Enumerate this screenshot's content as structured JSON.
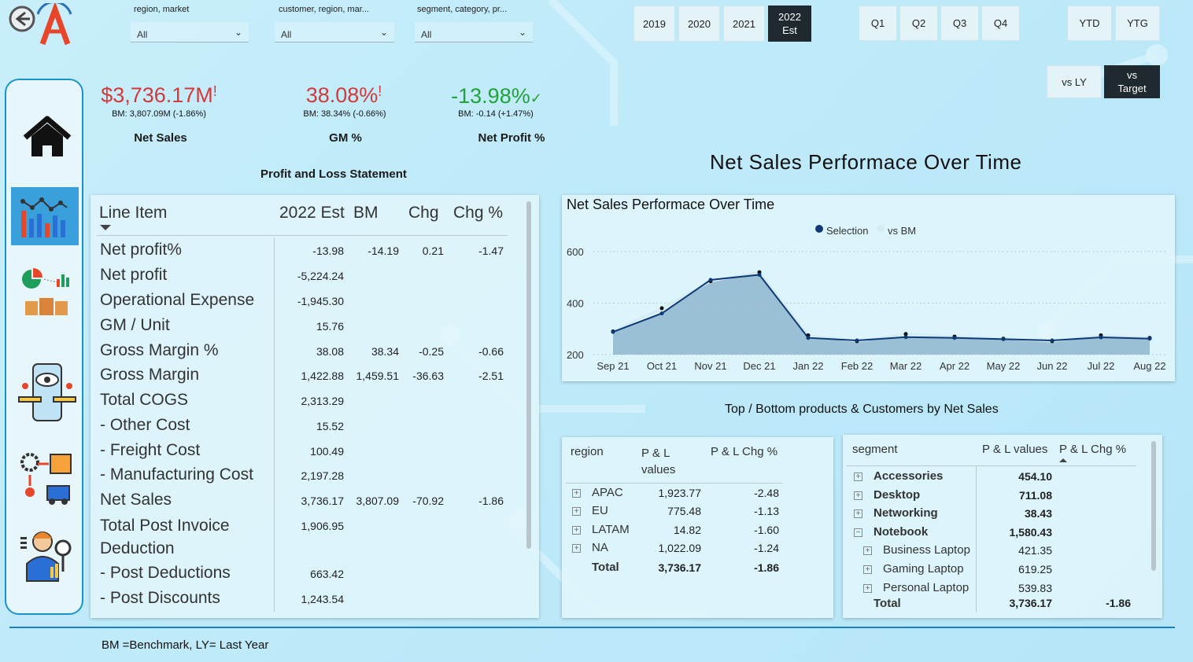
{
  "slicers": [
    {
      "label": "region, market",
      "value": "All"
    },
    {
      "label": "customer, region, mar...",
      "value": "All"
    },
    {
      "label": "segment, category, pr...",
      "value": "All"
    }
  ],
  "years": [
    "2019",
    "2020",
    "2021",
    "2022 Est"
  ],
  "selected_year": "2022 Est",
  "quarters": [
    "Q1",
    "Q2",
    "Q3",
    "Q4"
  ],
  "ytd": "YTD",
  "ytg": "YTG",
  "compare": {
    "ly": "vs LY",
    "target": "vs Target"
  },
  "kpis": [
    {
      "value": "$3,736.17M",
      "flag": "!",
      "bm": "BM: 3,807.09M (-1.86%)",
      "name": "Net Sales",
      "color": "#d23a3a"
    },
    {
      "value": "38.08%",
      "flag": "!",
      "bm": "BM: 38.34% (-0.66%)",
      "name": "GM %",
      "color": "#d23a3a"
    },
    {
      "value": "-13.98%",
      "flag": "✓",
      "bm": "BM: -0.14 (+1.47%)",
      "name": "Net Profit %",
      "color": "#22a33a"
    }
  ],
  "pnl": {
    "title": "Profit and Loss Statement",
    "headers": {
      "item": "Line Item",
      "est": "2022 Est",
      "bm": "BM",
      "chg": "Chg",
      "chgp": "Chg %"
    },
    "rows": [
      {
        "label": "Net profit%",
        "est": "-13.98",
        "bm": "-14.19",
        "chg": "0.21",
        "chgp": "-1.47"
      },
      {
        "label": "Net profit",
        "est": "-5,224.24",
        "bm": "",
        "chg": "",
        "chgp": ""
      },
      {
        "label": "Operational Expense",
        "est": "-1,945.30",
        "bm": "",
        "chg": "",
        "chgp": ""
      },
      {
        "label": "GM / Unit",
        "est": "15.76",
        "bm": "",
        "chg": "",
        "chgp": ""
      },
      {
        "label": "Gross Margin %",
        "est": "38.08",
        "bm": "38.34",
        "chg": "-0.25",
        "chgp": "-0.66"
      },
      {
        "label": "Gross Margin",
        "est": "1,422.88",
        "bm": "1,459.51",
        "chg": "-36.63",
        "chgp": "-2.51"
      },
      {
        "label": "Total COGS",
        "est": "2,313.29",
        "bm": "",
        "chg": "",
        "chgp": ""
      },
      {
        "label": "- Other Cost",
        "est": "15.52",
        "bm": "",
        "chg": "",
        "chgp": ""
      },
      {
        "label": "- Freight Cost",
        "est": "100.49",
        "bm": "",
        "chg": "",
        "chgp": ""
      },
      {
        "label": "- Manufacturing Cost",
        "est": "2,197.28",
        "bm": "",
        "chg": "",
        "chgp": ""
      },
      {
        "label": "Net Sales",
        "est": "3,736.17",
        "bm": "3,807.09",
        "chg": "-70.92",
        "chgp": "-1.86"
      },
      {
        "label": "Total Post Invoice Deduction",
        "est": "1,906.95",
        "bm": "",
        "chg": "",
        "chgp": ""
      },
      {
        "label": "- Post Deductions",
        "est": "663.42",
        "bm": "",
        "chg": "",
        "chgp": ""
      },
      {
        "label": "- Post Discounts",
        "est": "1,243.54",
        "bm": "",
        "chg": "",
        "chgp": ""
      }
    ]
  },
  "perf_title": "Net Sales Performace Over Time",
  "chart_data": {
    "type": "area",
    "title": "Net Sales Performace Over Time",
    "x": [
      "Sep 21",
      "Oct 21",
      "Nov 21",
      "Dec 21",
      "Jan 22",
      "Feb 22",
      "Mar 22",
      "Apr 22",
      "May 22",
      "Jun 22",
      "Jul 22",
      "Aug 22"
    ],
    "series": [
      {
        "name": "Selection",
        "values": [
          288,
          360,
          490,
          510,
          265,
          255,
          268,
          265,
          260,
          255,
          267,
          262
        ],
        "color": "#0e3a78"
      },
      {
        "name": "vs BM",
        "values": [
          290,
          380,
          485,
          520,
          275,
          252,
          280,
          270,
          262,
          252,
          275,
          265
        ],
        "color": "#d6ecf5"
      }
    ],
    "yticks": [
      200,
      400,
      600
    ],
    "ylim": [
      200,
      640
    ]
  },
  "top_bottom_title": "Top / Bottom products &  Customers by Net Sales",
  "region_table": {
    "headers": {
      "name": "region",
      "val": "P & L values",
      "chg": "P & L Chg %"
    },
    "rows": [
      {
        "name": "APAC",
        "val": "1,923.77",
        "chg": "-2.48"
      },
      {
        "name": "EU",
        "val": "775.48",
        "chg": "-1.13"
      },
      {
        "name": "LATAM",
        "val": "14.82",
        "chg": "-1.60"
      },
      {
        "name": "NA",
        "val": "1,022.09",
        "chg": "-1.24"
      }
    ],
    "total": {
      "name": "Total",
      "val": "3,736.17",
      "chg": "-1.86"
    }
  },
  "segment_table": {
    "headers": {
      "name": "segment",
      "val": "P & L values",
      "chg": "P & L Chg %"
    },
    "rows": [
      {
        "name": "Accessories",
        "val": "454.10",
        "bold": true,
        "exp": "+"
      },
      {
        "name": "Desktop",
        "val": "711.08",
        "bold": true,
        "exp": "+"
      },
      {
        "name": "Networking",
        "val": "38.43",
        "bold": true,
        "exp": "+"
      },
      {
        "name": "Notebook",
        "val": "1,580.43",
        "bold": true,
        "exp": "−"
      },
      {
        "name": "Business Laptop",
        "val": "421.35",
        "bold": false,
        "exp": "+"
      },
      {
        "name": "Gaming Laptop",
        "val": "619.25",
        "bold": false,
        "exp": "+"
      },
      {
        "name": "Personal Laptop",
        "val": "539.83",
        "bold": false,
        "exp": "+"
      }
    ],
    "total": {
      "name": "Total",
      "val": "3,736.17",
      "chg": "-1.86"
    }
  },
  "footer": "BM =Benchmark, LY= Last Year"
}
